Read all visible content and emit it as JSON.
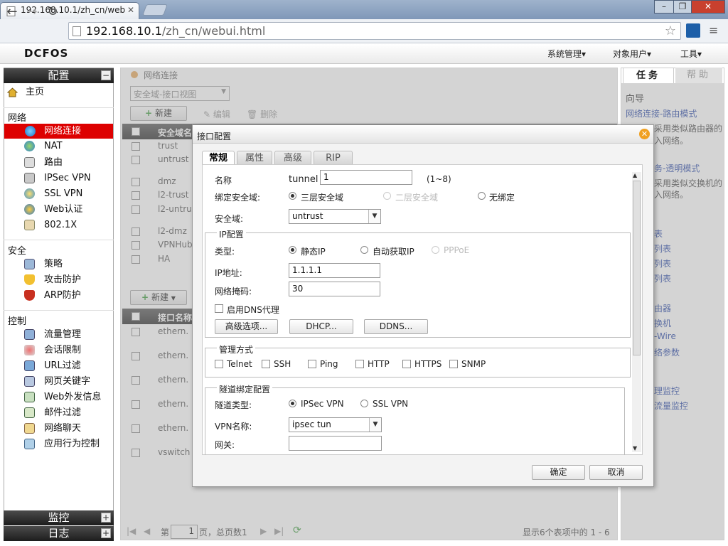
{
  "browser": {
    "tab_title": "192.168.10.1/zh_cn/web",
    "url_host": "192.168.10.1",
    "url_path": "/zh_cn/webui.html"
  },
  "app": {
    "logo": "DCFOS",
    "top_menu": [
      "系统管理▾",
      "对象用户▾",
      "工具▾"
    ]
  },
  "left": {
    "header": "配置",
    "home": "主页",
    "groups": [
      {
        "title": "网络",
        "items": [
          "网络连接",
          "NAT",
          "路由",
          "IPSec VPN",
          "SSL VPN",
          "Web认证",
          "802.1X"
        ]
      },
      {
        "title": "安全",
        "items": [
          "策略",
          "攻击防护",
          "ARP防护"
        ]
      },
      {
        "title": "控制",
        "items": [
          "流量管理",
          "会话限制",
          "URL过滤",
          "网页关键字",
          "Web外发信息",
          "邮件过滤",
          "网络聊天",
          "应用行为控制"
        ]
      }
    ],
    "footer": [
      "监控",
      "日志"
    ],
    "pm_expand": "+",
    "pm_collapse": "−"
  },
  "center": {
    "breadcrumb": "网络连接",
    "view_select": "安全域-接口视图",
    "new": "新建",
    "edit": "编辑",
    "delete": "删除",
    "zone_col": "安全域名",
    "zones": [
      "trust",
      "untrust",
      "dmz",
      "l2-trust",
      "l2-untru",
      "l2-dmz",
      "VPNHub",
      "HA"
    ],
    "if_new": "新建",
    "if_col": "接口名称",
    "interfaces": [
      "ethern.",
      "ethern.",
      "ethern.",
      "ethern.",
      "ethern.",
      "vswitch"
    ],
    "pager": {
      "page_prefix": "第",
      "page": "1",
      "page_suffix": "页，总页数1",
      "summary": "显示6个表项中的 1 - 6"
    }
  },
  "right": {
    "tabs": [
      "任务",
      "帮助"
    ],
    "guide": "向导",
    "link_route": "网络连接-路由模式",
    "desc_route": [
      "采用类似路由器的",
      "入网络。"
    ],
    "link_trans": "务-透明模式",
    "desc_trans": [
      "采用类似交换机的",
      "入网络。"
    ],
    "links": [
      "表",
      "列表",
      "列表",
      "列表",
      "由器",
      "换机",
      "-Wire",
      "络参数",
      "理监控",
      "流量监控"
    ]
  },
  "dialog": {
    "title": "接口配置",
    "tabs": [
      "常规",
      "属性",
      "高级",
      "RIP"
    ],
    "name_label": "名称",
    "name_prefix": "tunnel",
    "name_value": "1",
    "name_hint": "(1~8)",
    "bind_label": "绑定安全域:",
    "bind_opts": [
      "三层安全域",
      "二层安全域",
      "无绑定"
    ],
    "zone_label": "安全域:",
    "zone_value": "untrust",
    "ip_legend": "IP配置",
    "type_label": "类型:",
    "type_opts": [
      "静态IP",
      "自动获取IP",
      "PPPoE"
    ],
    "ip_label": "IP地址:",
    "ip_value": "1.1.1.1",
    "mask_label": "网络掩码:",
    "mask_value": "30",
    "dns_proxy": "启用DNS代理",
    "adv_btn": "高级选项...",
    "dhcp_btn": "DHCP...",
    "ddns_btn": "DDNS...",
    "mgmt_legend": "管理方式",
    "mgmt_opts": [
      "Telnet",
      "SSH",
      "Ping",
      "HTTP",
      "HTTPS",
      "SNMP"
    ],
    "tunnel_legend": "隧道绑定配置",
    "tunnel_type_label": "隧道类型:",
    "tunnel_types": [
      "IPSec VPN",
      "SSL VPN"
    ],
    "vpn_name_label": "VPN名称:",
    "vpn_name_value": "ipsec tun",
    "gateway_label": "网关:",
    "gateway_value": "",
    "ok": "确定",
    "cancel": "取消"
  }
}
